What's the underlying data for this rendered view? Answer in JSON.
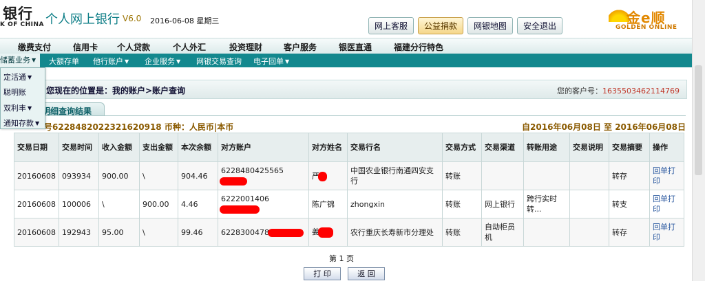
{
  "header": {
    "brand_name": "银行",
    "brand_sub": "K OF CHINA",
    "title": "个人网上银行",
    "version": "V6.0",
    "date": "2016-06-08 星期三",
    "buttons": [
      "网上客服",
      "公益捐款",
      "网银地图",
      "安全退出"
    ],
    "logo_cn": "金e顺",
    "logo_en": "GOLDEN ONLINE"
  },
  "main_nav": [
    "缴费支付",
    "信用卡",
    "个人贷款",
    "个人外汇",
    "投资理财",
    "客户服务",
    "银医直通",
    "福建分行特色"
  ],
  "sub_nav": [
    "储蓄业务",
    "大额存单",
    "他行账户",
    "企业服务",
    "网银交易查询",
    "电子回单"
  ],
  "dropdown": [
    "定活通",
    "聪明账",
    "双利丰",
    "通知存款"
  ],
  "location": {
    "text": "您现在的位置是：我的账户>账户查询",
    "customer_label": "您的客户号：",
    "customer_no": "1635503462114769"
  },
  "tab": {
    "label": "明细查询结果"
  },
  "account": {
    "line": "号6228482022321620918 币种：人民币|本币",
    "range": "自2016年06月08日 至 2016年06月08日"
  },
  "table": {
    "headers": [
      "交易日期",
      "交易时间",
      "收入金额",
      "支出金额",
      "本次余额",
      "对方账户",
      "对方姓名",
      "交易行名",
      "交易方式",
      "交易渠道",
      "转账用途",
      "交易说明",
      "交易摘要",
      "操作"
    ],
    "rows": [
      [
        "20160608",
        "093934",
        "900.00",
        "\\",
        "904.46",
        "6228480425565",
        "严",
        "中国农业银行南通四安支行",
        "转账",
        "",
        "",
        "",
        "转存",
        "回单打印"
      ],
      [
        "20160608",
        "100006",
        "\\",
        "900.00",
        "4.46",
        "6222001406",
        "陈广锦",
        "zhongxin",
        "转账",
        "网上银行",
        "跨行实时转...",
        "",
        "转支",
        "回单打印"
      ],
      [
        "20160608",
        "192943",
        "95.00",
        "\\",
        "99.46",
        "6228300478",
        "姜",
        "农行重庆长寿新市分理处",
        "转账",
        "自动柜员机",
        "",
        "",
        "转存",
        "回单打印"
      ]
    ]
  },
  "pager": "第 1 页",
  "bottom_buttons": [
    "打 印",
    "返 回"
  ],
  "colors": {
    "teal": "#13888e",
    "redaction": "#ff0000",
    "link": "#2c5aa0"
  }
}
